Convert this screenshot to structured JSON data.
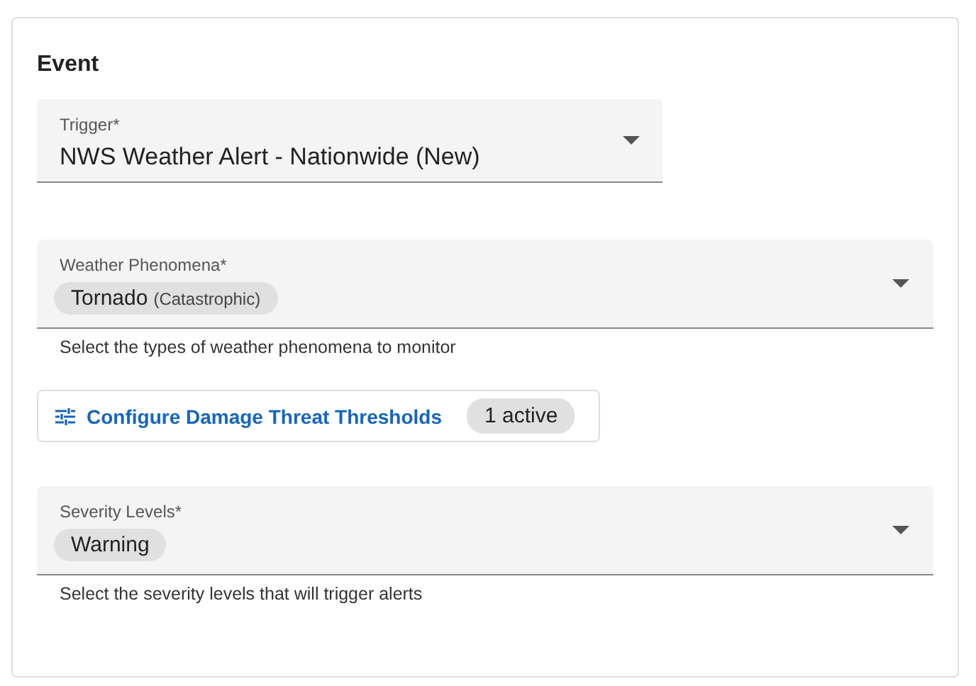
{
  "card": {
    "title": "Event"
  },
  "trigger": {
    "label": "Trigger*",
    "value": "NWS Weather Alert - Nationwide (New)"
  },
  "phenomena": {
    "label": "Weather Phenomena*",
    "chips": [
      {
        "text": "Tornado",
        "note": "(Catastrophic)"
      }
    ],
    "helper": "Select the types of weather phenomena to monitor"
  },
  "thresholds": {
    "label": "Configure Damage Threat Thresholds",
    "badge": "1 active"
  },
  "severity": {
    "label": "Severity Levels*",
    "chips": [
      {
        "text": "Warning"
      }
    ],
    "helper": "Select the severity levels that will trigger alerts"
  }
}
